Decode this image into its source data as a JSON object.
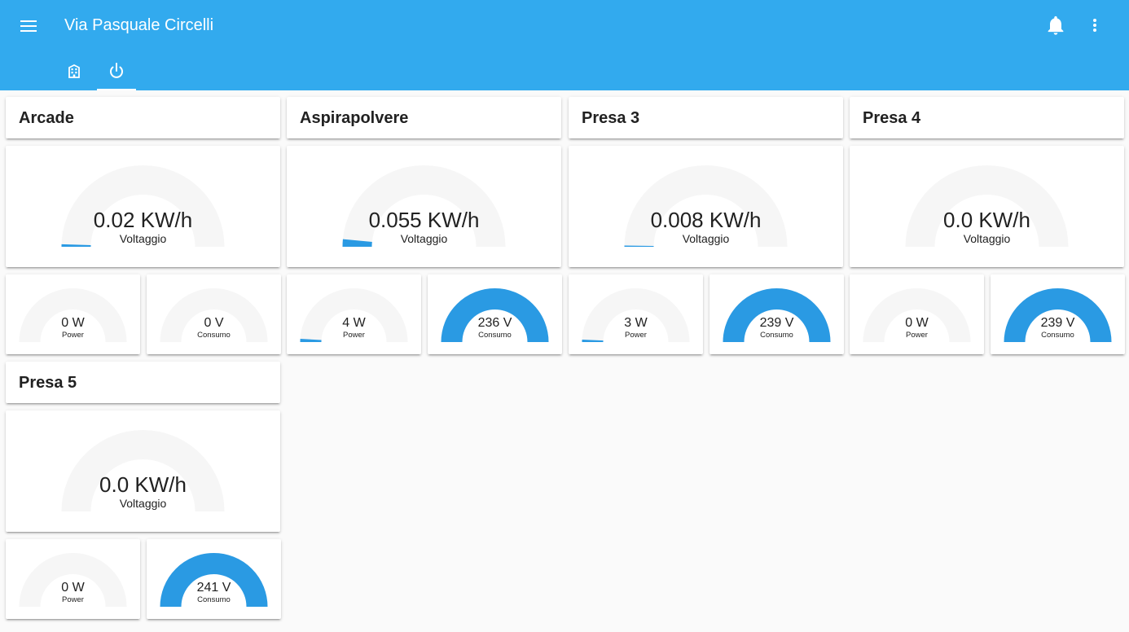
{
  "header": {
    "title": "Via Pasquale Circelli",
    "menu_icon": "menu-icon",
    "notifications_icon": "bell-icon",
    "more_icon": "more-vertical-icon",
    "color": "#32aaee"
  },
  "tabs": [
    {
      "icon": "building-icon",
      "active": false
    },
    {
      "icon": "power-icon",
      "active": true
    }
  ],
  "colors": {
    "gauge_fill": "#2a9ae3",
    "gauge_track": "#f6f6f6"
  },
  "devices": [
    {
      "name": "Arcade",
      "energy": {
        "value": "0.02 KW/h",
        "label": "Voltaggio",
        "fill": 0.01
      },
      "power": {
        "value": "0 W",
        "label": "Power",
        "fill": 0
      },
      "voltage": {
        "value": "0 V",
        "label": "Consumo",
        "fill": 0
      }
    },
    {
      "name": "Aspirapolvere",
      "energy": {
        "value": "0.055 KW/h",
        "label": "Voltaggio",
        "fill": 0.03
      },
      "power": {
        "value": "4 W",
        "label": "Power",
        "fill": 0.02
      },
      "voltage": {
        "value": "236 V",
        "label": "Consumo",
        "fill": 1
      }
    },
    {
      "name": "Presa 3",
      "energy": {
        "value": "0.008 KW/h",
        "label": "Voltaggio",
        "fill": 0.005
      },
      "power": {
        "value": "3 W",
        "label": "Power",
        "fill": 0.015
      },
      "voltage": {
        "value": "239 V",
        "label": "Consumo",
        "fill": 1
      }
    },
    {
      "name": "Presa 4",
      "energy": {
        "value": "0.0 KW/h",
        "label": "Voltaggio",
        "fill": 0
      },
      "power": {
        "value": "0 W",
        "label": "Power",
        "fill": 0
      },
      "voltage": {
        "value": "239 V",
        "label": "Consumo",
        "fill": 1
      }
    },
    {
      "name": "Presa 5",
      "energy": {
        "value": "0.0 KW/h",
        "label": "Voltaggio",
        "fill": 0
      },
      "power": {
        "value": "0 W",
        "label": "Power",
        "fill": 0
      },
      "voltage": {
        "value": "241 V",
        "label": "Consumo",
        "fill": 1
      }
    }
  ]
}
